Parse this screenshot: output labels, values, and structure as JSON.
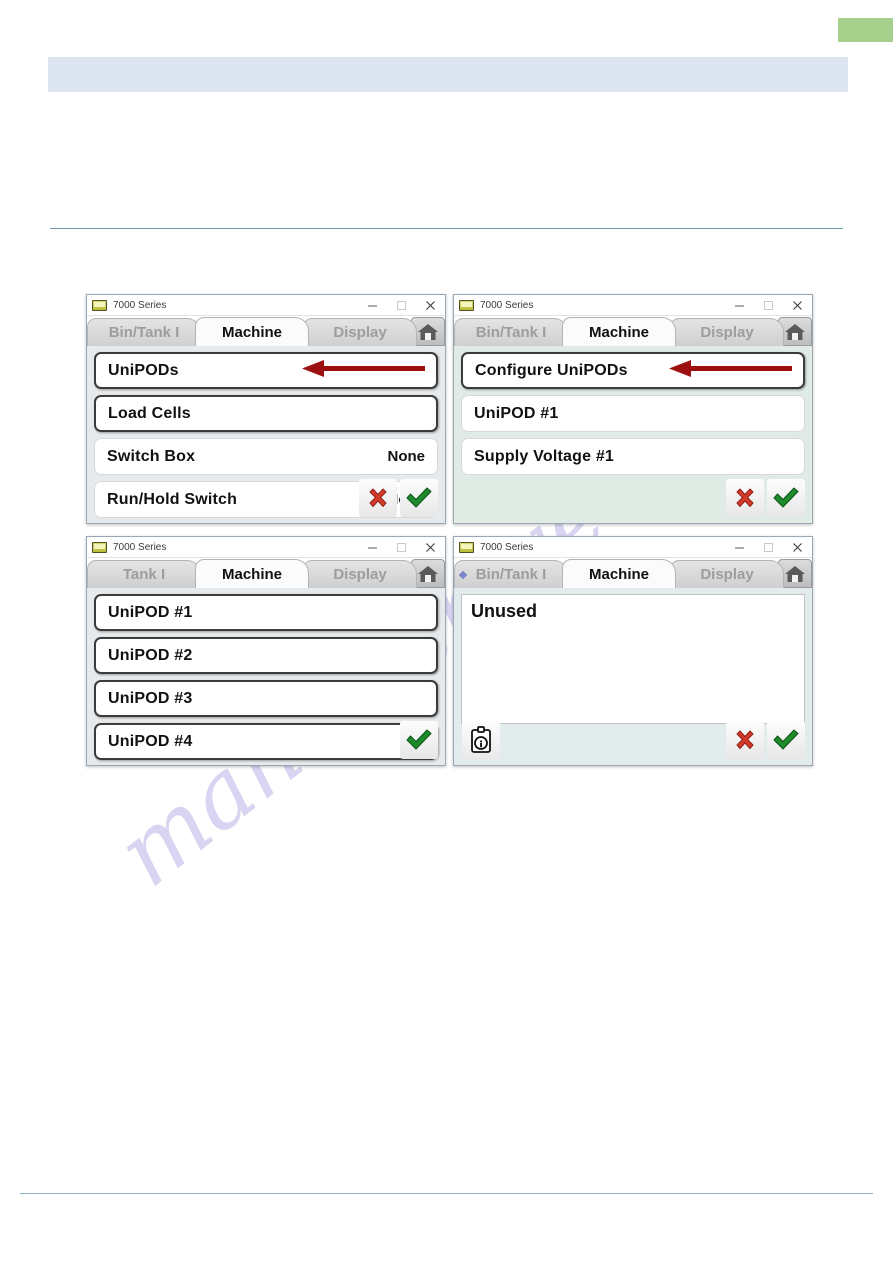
{
  "page": {
    "green_tab_color": "#a8d08d",
    "blue_bar_color": "#dde6f0",
    "rule_color": "#6f9bb0",
    "watermark_text": "manualshive.com"
  },
  "palette": {
    "arrow_red": "#9c1010",
    "check_green": "#1d8a2b",
    "cross_red": "#d43a2a",
    "pane_gray": "#e7eaec",
    "pane_green": "#e0ebe6",
    "pane_teal": "#e2ecec",
    "tab_active_text": "#111111",
    "tab_inactive_text": "#9d9d9d"
  },
  "windows": [
    {
      "id": "win-machine-unipods",
      "title": "7000 Series",
      "title_icon": "device-icon",
      "controls": {
        "minimize": "minimize-icon",
        "maximize": "maximize-icon",
        "close": "close-icon"
      },
      "tabs": [
        {
          "label": "Bin/Tank  I",
          "active": false,
          "dot": false
        },
        {
          "label": "Machine",
          "active": true,
          "dot": false
        },
        {
          "label": "Display",
          "active": false,
          "dot": false
        }
      ],
      "home_button": "home-icon",
      "pane_style": "gray",
      "rows": [
        {
          "label": "UniPODs",
          "value": "",
          "selected": true
        },
        {
          "label": "Load  Cells",
          "value": "",
          "selected": true
        },
        {
          "label": "Switch  Box",
          "value": "None",
          "selected": false
        },
        {
          "label": "Run/Hold  Switch",
          "value": "None",
          "selected": false
        }
      ],
      "actions": [
        {
          "name": "cancel-button",
          "icon": "cross-icon"
        },
        {
          "name": "confirm-button",
          "icon": "check-icon"
        }
      ],
      "info_button": null,
      "arrow": {
        "target_row": 0
      }
    },
    {
      "id": "win-configure-unipods",
      "title": "7000 Series",
      "title_icon": "device-icon",
      "controls": {
        "minimize": "minimize-icon",
        "maximize": "maximize-icon",
        "close": "close-icon"
      },
      "tabs": [
        {
          "label": "Bin/Tank  I",
          "active": false,
          "dot": false
        },
        {
          "label": "Machine",
          "active": true,
          "dot": false
        },
        {
          "label": "Display",
          "active": false,
          "dot": false
        }
      ],
      "home_button": "home-icon",
      "pane_style": "green",
      "rows": [
        {
          "label": "Configure  UniPODs",
          "value": "",
          "selected": true
        },
        {
          "label": "UniPOD  #1",
          "value": "",
          "selected": false
        },
        {
          "label": "Supply Voltage  #1",
          "value": "",
          "selected": false
        }
      ],
      "actions": [
        {
          "name": "cancel-button",
          "icon": "cross-icon"
        },
        {
          "name": "confirm-button",
          "icon": "check-icon"
        }
      ],
      "info_button": null,
      "arrow": {
        "target_row": 0
      }
    },
    {
      "id": "win-unipod-list",
      "title": "7000 Series",
      "title_icon": "device-icon",
      "controls": {
        "minimize": "minimize-icon",
        "maximize": "maximize-icon",
        "close": "close-icon"
      },
      "tabs": [
        {
          "label": "Tank  I",
          "active": false,
          "dot": false
        },
        {
          "label": "Machine",
          "active": true,
          "dot": false
        },
        {
          "label": "Display",
          "active": false,
          "dot": false
        }
      ],
      "home_button": "home-icon",
      "pane_style": "gray",
      "rows": [
        {
          "label": "UniPOD  #1",
          "value": "",
          "selected": true
        },
        {
          "label": "UniPOD  #2",
          "value": "",
          "selected": true
        },
        {
          "label": "UniPOD  #3",
          "value": "",
          "selected": true
        },
        {
          "label": "UniPOD  #4",
          "value": "",
          "selected": true
        }
      ],
      "actions": [
        {
          "name": "confirm-button",
          "icon": "check-icon"
        }
      ],
      "info_button": null,
      "arrow": null
    },
    {
      "id": "win-unipod-unused",
      "title": "7000 Series",
      "title_icon": "device-icon",
      "controls": {
        "minimize": "minimize-icon",
        "maximize": "maximize-icon",
        "close": "close-icon"
      },
      "tabs": [
        {
          "label": "Bin/Tank  I",
          "active": false,
          "dot": true
        },
        {
          "label": "Machine",
          "active": true,
          "dot": false
        },
        {
          "label": "Display",
          "active": false,
          "dot": false
        }
      ],
      "home_button": "home-icon",
      "pane_style": "teal",
      "text_panel": "Unused",
      "rows": [],
      "actions": [
        {
          "name": "cancel-button",
          "icon": "cross-icon"
        },
        {
          "name": "confirm-button",
          "icon": "check-icon"
        }
      ],
      "info_button": "clipboard-info-icon",
      "arrow": null
    }
  ]
}
